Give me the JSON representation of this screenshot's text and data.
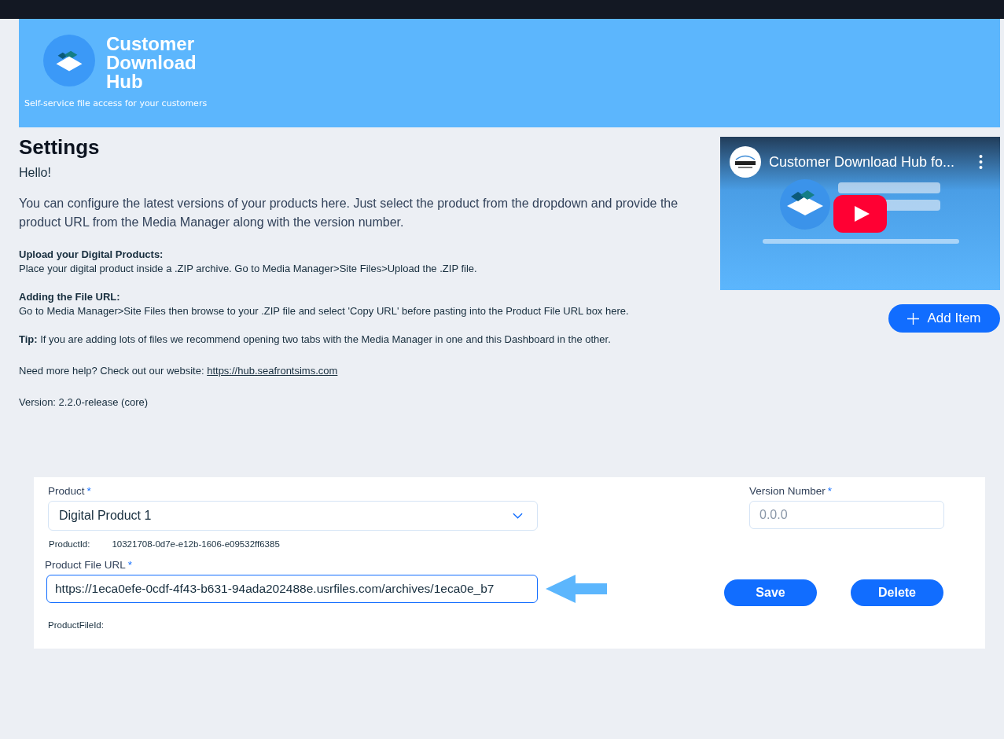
{
  "header": {
    "brand_title": "Customer Download Hub",
    "tagline": "Self-service file access for your customers"
  },
  "page": {
    "title": "Settings",
    "greeting": "Hello!",
    "intro": "You can configure the latest versions of your products here. Just select the product from the dropdown and provide the product URL from the Media Manager along with the version number.",
    "sections": [
      {
        "heading": "Upload your Digital Products:",
        "text": "Place your digital product inside a .ZIP archive. Go to Media Manager>Site Files>Upload the .ZIP file."
      },
      {
        "heading": "Adding the File URL:",
        "text": "Go to Media Manager>Site Files then browse to your .ZIP file and select 'Copy URL' before pasting into the Product File URL box here."
      }
    ],
    "tip": "**Tip:** If you are adding lots of files we recommend opening two tabs with the Media Manager in one and this Dashboard in the other.",
    "help": {
      "text": "Need more help? Check out our website: ",
      "link": "https://hub.seafrontsims.com"
    },
    "version": "Version: 2.2.0-release (core)"
  },
  "video": {
    "kind": "picture",
    "title": "Customer Download Hub fo..."
  },
  "add_button": {
    "label": "Add Item"
  },
  "form": {
    "product": {
      "label": "Product",
      "required_mark": "*",
      "value": "Digital Product 1"
    },
    "product_id": {
      "label": "ProductId:",
      "value": "10321708-0d7e-e12b-1606-e09532ff6385"
    },
    "file_url": {
      "label": "Product File URL",
      "required_mark": "*",
      "value": "https://1eca0efe-0cdf-4f43-b631-94ada202488e.usrfiles.com/archives/1eca0e_b7",
      "focused": true
    },
    "version_number": {
      "label": "Version Number",
      "required_mark": "*",
      "placeholder": "0.0.0"
    },
    "product_file_id": {
      "label": "ProductFileId:"
    },
    "buttons": [
      {
        "label": "Save"
      },
      {
        "label": "Delete"
      }
    ]
  }
}
